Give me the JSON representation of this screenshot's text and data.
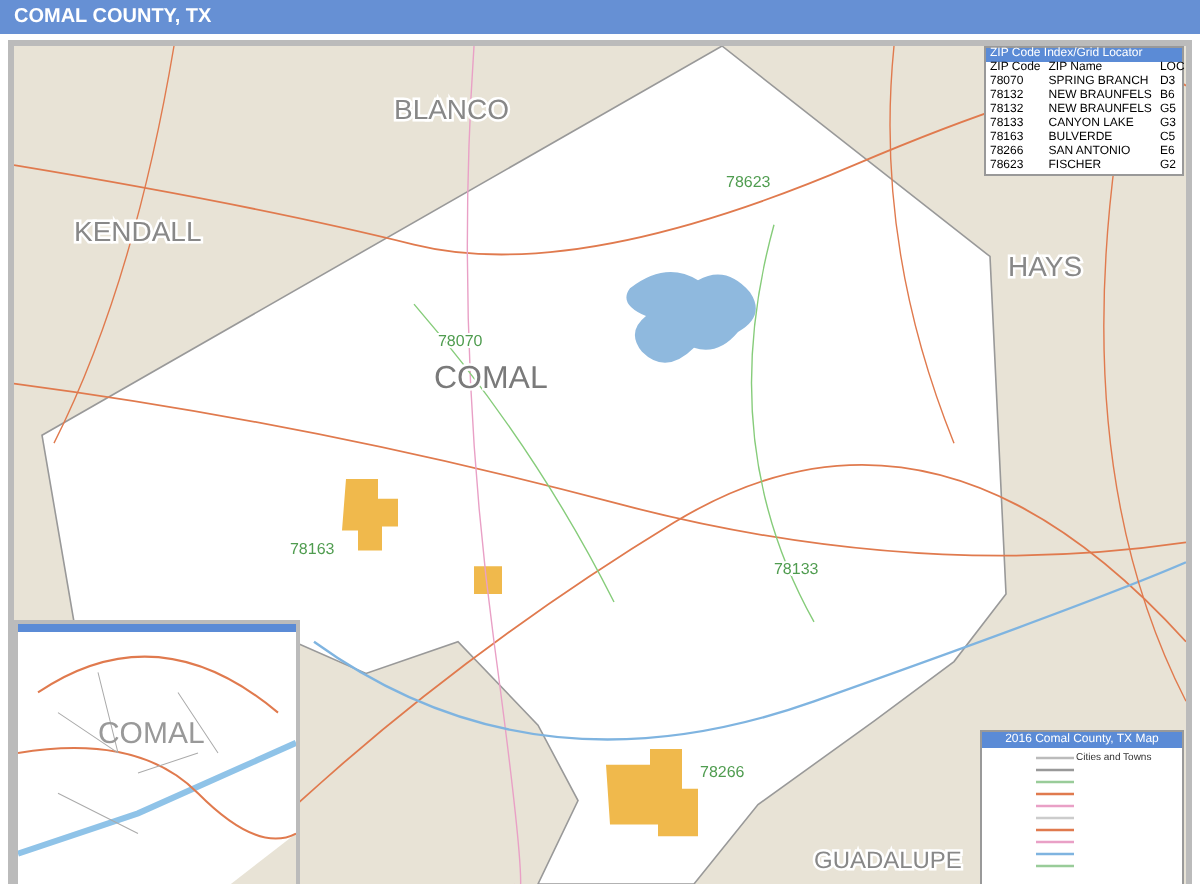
{
  "header": {
    "title": "COMAL COUNTY, TX"
  },
  "map": {
    "county_labels": [
      {
        "text": "BLANCO",
        "kind": "neighbor"
      },
      {
        "text": "KENDALL",
        "kind": "neighbor"
      },
      {
        "text": "HAYS",
        "kind": "neighbor"
      },
      {
        "text": "COMAL",
        "kind": "county"
      },
      {
        "text": "GUADALUPE",
        "kind": "neighbor"
      }
    ],
    "zip_labels": [
      "78623",
      "78070",
      "78163",
      "78133",
      "78266"
    ]
  },
  "zip_index": {
    "title": "ZIP Code Index/Grid Locator",
    "columns": [
      "ZIP Code",
      "ZIP Name",
      "LOC"
    ],
    "rows": [
      [
        "78070",
        "SPRING BRANCH",
        "D3"
      ],
      [
        "78132",
        "NEW BRAUNFELS",
        "B6"
      ],
      [
        "78132",
        "NEW BRAUNFELS",
        "G5"
      ],
      [
        "78133",
        "CANYON LAKE",
        "G3"
      ],
      [
        "78163",
        "BULVERDE",
        "C5"
      ],
      [
        "78266",
        "SAN ANTONIO",
        "E6"
      ],
      [
        "78623",
        "FISCHER",
        "G2"
      ]
    ]
  },
  "inset": {
    "label": "COMAL"
  },
  "legend": {
    "title": "2016 Comal County, TX Map",
    "subtitle": "Cities and Towns"
  }
}
